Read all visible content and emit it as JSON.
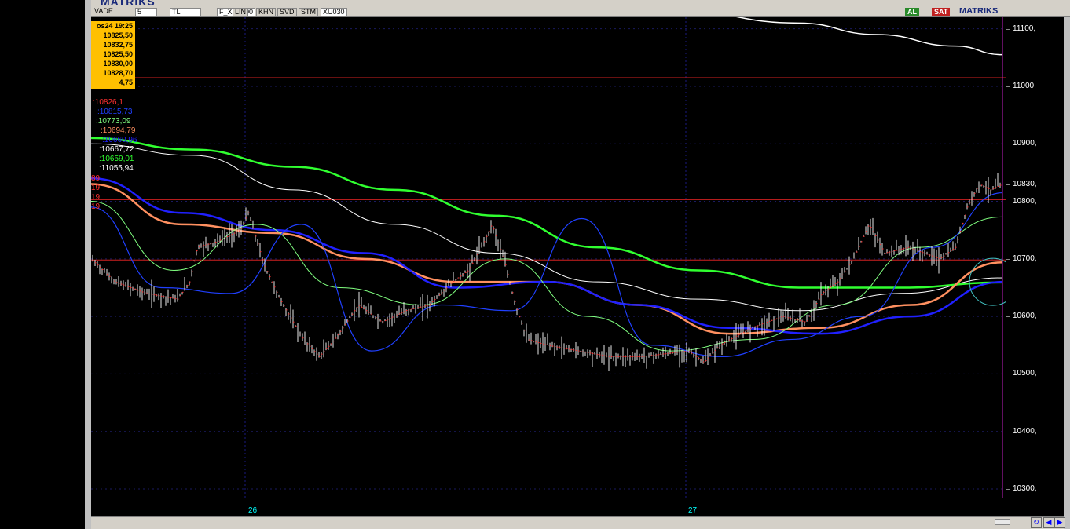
{
  "toolbar": {
    "logo": "MATRIKS",
    "logo_right": "MATRIKS",
    "vade_label": "VADE",
    "period_value": "5",
    "currency_value": "TL",
    "chart_type_lin": "LIN",
    "chart_type_khn": "KHN",
    "chart_type_svd": "SVD",
    "chart_type_stm": "STM",
    "chart_type_tmp": "TMP",
    "symbol_field": "F_XU0300",
    "index_field": "XU030",
    "al_button": "AL",
    "sat_button": "SAT"
  },
  "info_box": {
    "datetime": "os24 19:25",
    "open": "10825,50",
    "high": "10832,75",
    "low": "10825,50",
    "close": "10830,00",
    "avg": "10828,70",
    "change": "4,75"
  },
  "indicators": [
    {
      "label": ":10826,1",
      "color": "#ff3030"
    },
    {
      "label": ":10815,73",
      "color": "#2040ff"
    },
    {
      "label": ":10773,09",
      "color": "#80ff80"
    },
    {
      "label": ":10694,79",
      "color": "#ff9060"
    },
    {
      "label": ":10660,96",
      "color": "#2020ff"
    },
    {
      "label": ":10667,72",
      "color": "#ffffff"
    },
    {
      "label": ":10659,01",
      "color": "#30ff30"
    },
    {
      "label": ":11055,94",
      "color": "#ffffff"
    }
  ],
  "side_labels": [
    "89",
    "19",
    "19",
    "19"
  ],
  "price_axis": {
    "labels": [
      "11100,",
      "11000,",
      "10900,",
      "10830,",
      "10800,",
      "10700,",
      "10600,",
      "10500,",
      "10400,",
      "10300,"
    ]
  },
  "date_axis": {
    "labels": [
      "26",
      "27"
    ]
  },
  "chart_data": {
    "type": "line",
    "title": "",
    "y_axis_ticks": [
      11100,
      11000,
      10900,
      10800,
      10700,
      10600,
      10500,
      10400,
      10300
    ],
    "ylim": [
      10285,
      11120
    ],
    "x_categories": [
      "26",
      "27"
    ],
    "last_price": 10830,
    "horizontal_lines": [
      11015,
      10803,
      10698
    ],
    "series": [
      {
        "color": "#ffffff",
        "values": [
          11170,
          11150,
          11130,
          11110,
          11090,
          11070,
          11055
        ]
      },
      {
        "color": "#ffffff",
        "values": [
          10900,
          10880,
          10820,
          10760,
          10710,
          10660,
          10630,
          10610,
          10640,
          10667
        ]
      },
      {
        "color": "#30ff30",
        "values": [
          10910,
          10890,
          10860,
          10820,
          10775,
          10720,
          10680,
          10650,
          10650,
          10659
        ]
      },
      {
        "color": "#ff9060",
        "values": [
          10830,
          10760,
          10745,
          10700,
          10660,
          10660,
          10620,
          10570,
          10580,
          10620,
          10694
        ]
      },
      {
        "color": "#2020ff",
        "values": [
          10840,
          10780,
          10750,
          10710,
          10650,
          10660,
          10620,
          10580,
          10570,
          10600,
          10660
        ]
      },
      {
        "color": "#80ff80",
        "values": [
          10800,
          10680,
          10760,
          10650,
          10620,
          10700,
          10600,
          10540,
          10560,
          10620,
          10720,
          10773
        ]
      },
      {
        "color": "#2040ff",
        "values": [
          10790,
          10650,
          10640,
          10760,
          10540,
          10620,
          10610,
          10770,
          10550,
          10530,
          10560,
          10600,
          10720,
          10815
        ]
      }
    ]
  }
}
